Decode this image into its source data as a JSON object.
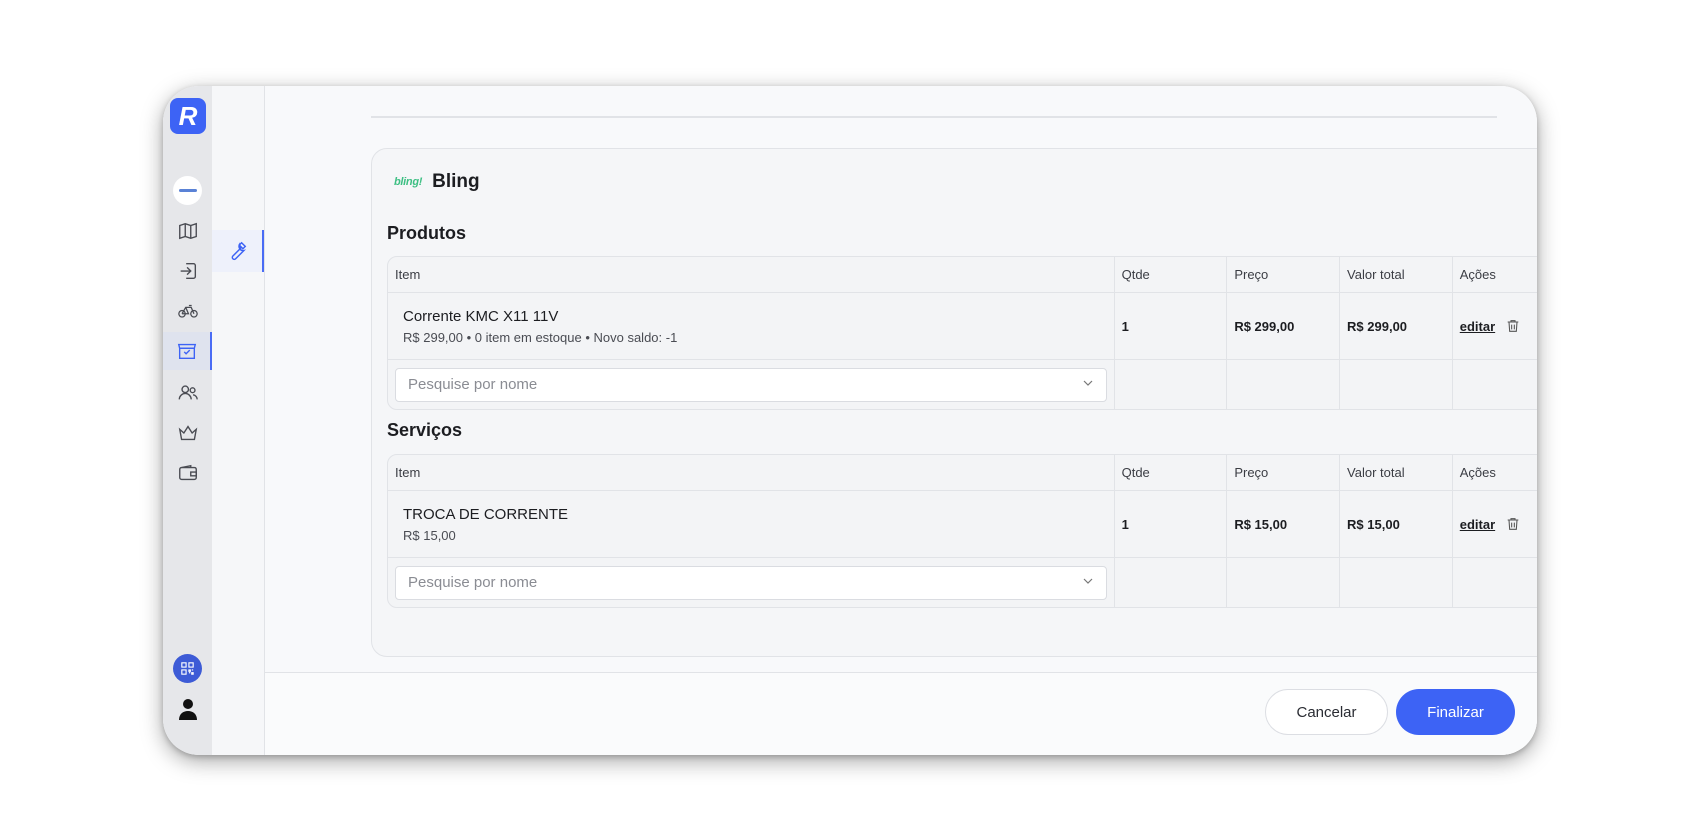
{
  "app": {
    "logo_letter": "R"
  },
  "sidebar": {
    "icons": [
      "map-icon",
      "login-icon",
      "bicycle-icon",
      "store-icon",
      "users-icon",
      "crown-icon",
      "wallet-icon"
    ],
    "active": "store-icon"
  },
  "subnav": {
    "active_icon": "wrench-icon"
  },
  "integration": {
    "logo_text": "bling!",
    "title": "Bling"
  },
  "produtos": {
    "title": "Produtos",
    "headers": {
      "item": "Item",
      "qty": "Qtde",
      "price": "Preço",
      "total": "Valor total",
      "actions": "Ações"
    },
    "rows": [
      {
        "name": "Corrente KMC X11 11V",
        "sub": "R$ 299,00 • 0 item em estoque • Novo saldo: -1",
        "qty": "1",
        "price": "R$ 299,00",
        "total": "R$ 299,00",
        "edit": "editar"
      }
    ],
    "search_placeholder": "Pesquise por nome"
  },
  "servicos": {
    "title": "Serviços",
    "headers": {
      "item": "Item",
      "qty": "Qtde",
      "price": "Preço",
      "total": "Valor total",
      "actions": "Ações"
    },
    "rows": [
      {
        "name": "TROCA DE CORRENTE",
        "sub": "R$ 15,00",
        "qty": "1",
        "price": "R$ 15,00",
        "total": "R$ 15,00",
        "edit": "editar"
      }
    ],
    "search_placeholder": "Pesquise por nome"
  },
  "footer": {
    "cancel_label": "Cancelar",
    "finish_label": "Finalizar"
  },
  "colors": {
    "accent": "#3d63f5",
    "bling_green": "#3dbf83"
  }
}
